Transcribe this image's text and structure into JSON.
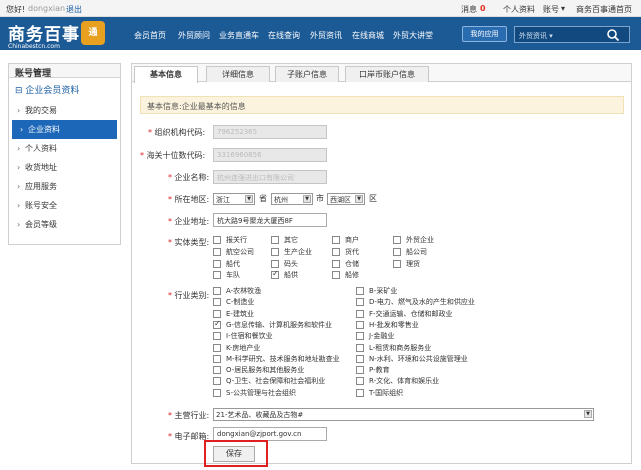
{
  "topbar": {
    "greeting": "您好!",
    "username": "dongxian",
    "logout": "退出",
    "messages_label": "消息",
    "messages_count": "0",
    "personal": "个人资料",
    "account": "账号",
    "site_link": "商务百事通首页"
  },
  "nav": {
    "logo_cn": "商务百事",
    "logo_en": "Chinabestcn.com",
    "logo_mark": "通",
    "items": [
      "会员首页",
      "外贸顾问",
      "业务直通车",
      "在线查询",
      "外贸资讯",
      "在线商城",
      "外贸大讲堂"
    ],
    "my_apps": "我的应用",
    "search_placeholder": "外贸资讯"
  },
  "sidebar": {
    "title": "账号管理",
    "section": "企业会员资料",
    "items": [
      "我的交易",
      "企业资料",
      "个人资料",
      "收货地址",
      "应用服务",
      "账号安全",
      "会员等级"
    ]
  },
  "tabs": [
    "基本信息",
    "详细信息",
    "子账户信息",
    "口岸币账户信息"
  ],
  "notice": "基本信息:企业最基本的信息",
  "form": {
    "org_code_label": "组织机构代码:",
    "org_code_value": "796252365",
    "customs_label": "海关十位数代码:",
    "customs_value": "3316960856",
    "company_label": "企业名称:",
    "company_value": "杭州连强进出口有限公司",
    "region_label": "所在地区:",
    "province": "浙江",
    "province_unit": "省",
    "city": "杭州",
    "city_unit": "市",
    "district": "西湖区",
    "district_unit": "区",
    "address_label": "企业地址:",
    "address_value": "杭大路9号聚龙大厦西8F",
    "entity_label": "实体类型:",
    "entity_types": [
      {
        "label": "报关行",
        "checked": false
      },
      {
        "label": "其它",
        "checked": false
      },
      {
        "label": "商户",
        "checked": false
      },
      {
        "label": "外贸企业",
        "checked": false
      },
      {
        "label": "航空公司",
        "checked": false
      },
      {
        "label": "生产企业",
        "checked": false
      },
      {
        "label": "货代",
        "checked": false
      },
      {
        "label": "船公司",
        "checked": false
      },
      {
        "label": "船代",
        "checked": false
      },
      {
        "label": "码头",
        "checked": false
      },
      {
        "label": "仓储",
        "checked": false
      },
      {
        "label": "理货",
        "checked": false
      },
      {
        "label": "车队",
        "checked": false
      },
      {
        "label": "船供",
        "checked": true
      },
      {
        "label": "船修",
        "checked": false
      }
    ],
    "industry_label": "行业类别:",
    "industries": [
      {
        "label": "A-农林牧渔",
        "checked": false
      },
      {
        "label": "B-采矿业",
        "checked": false
      },
      {
        "label": "C-制造业",
        "checked": false
      },
      {
        "label": "D-电力、燃气及水的产生和供应业",
        "checked": false
      },
      {
        "label": "E-建筑业",
        "checked": false
      },
      {
        "label": "F-交通运输、仓储和邮政业",
        "checked": false
      },
      {
        "label": "G-信息传输、计算机服务和软件业",
        "checked": true
      },
      {
        "label": "H-批发和零售业",
        "checked": false
      },
      {
        "label": "I-住宿和餐饮业",
        "checked": false
      },
      {
        "label": "J-金融业",
        "checked": false
      },
      {
        "label": "K-房地产业",
        "checked": false
      },
      {
        "label": "L-租赁和商务服务业",
        "checked": false
      },
      {
        "label": "M-科学研究、技术服务和地址勘查业",
        "checked": false
      },
      {
        "label": "N-水利、环境和公共设施管理业",
        "checked": false
      },
      {
        "label": "O-居民服务和其他服务业",
        "checked": false
      },
      {
        "label": "P-教育",
        "checked": false
      },
      {
        "label": "Q-卫生、社会保障和社会福利业",
        "checked": false
      },
      {
        "label": "R-文化、体育和娱乐业",
        "checked": false
      },
      {
        "label": "S-公共管理与社会组织",
        "checked": false
      },
      {
        "label": "T-国际组织",
        "checked": false
      }
    ],
    "main_industry_label": "主营行业:",
    "main_industry_value": "21-艺术品、收藏品及古物#",
    "email_label": "电子邮箱:",
    "email_value": "dongxian@zjport.gov.cn",
    "save": "保存"
  }
}
